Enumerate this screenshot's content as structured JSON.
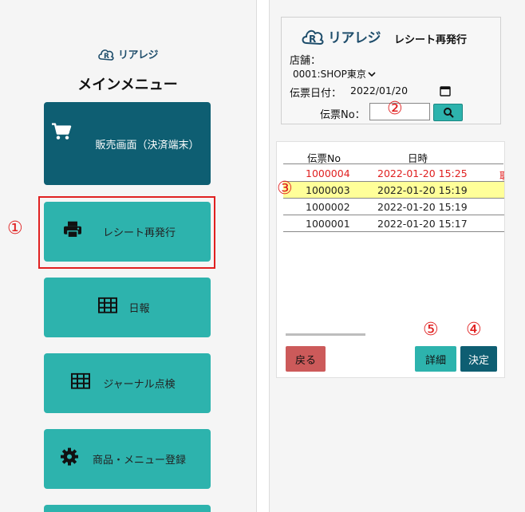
{
  "left": {
    "logo_text": "リアレジ",
    "menu_title": "メインメニュー",
    "buttons": {
      "sales": "販売画面（決済端末）",
      "receipt": "レシート再発行",
      "daily": "日報",
      "journal": "ジャーナル点検",
      "product": "商品・メニュー登録"
    },
    "marker_1": "①"
  },
  "right": {
    "logo_text": "リアレジ",
    "title": "レシート再発行",
    "store_label": "店舗：",
    "store_value": "0001:SHOP東京",
    "date_label": "伝票日付：",
    "date_value": "2022/01/20",
    "slip_label": "伝票No：",
    "slip_value": "",
    "columns": {
      "slip_no": "伝票No",
      "datetime": "日時"
    },
    "rows": [
      {
        "slip_no": "1000004",
        "datetime": "2022-01-20 15:25",
        "extra": "取"
      },
      {
        "slip_no": "1000003",
        "datetime": "2022-01-20 15:19",
        "extra": ""
      },
      {
        "slip_no": "1000002",
        "datetime": "2022-01-20 15:19",
        "extra": ""
      },
      {
        "slip_no": "1000001",
        "datetime": "2022-01-20 15:17",
        "extra": ""
      }
    ],
    "buttons": {
      "back": "戻る",
      "detail": "詳細",
      "ok": "決定"
    },
    "markers": {
      "m2": "②",
      "m3": "③",
      "m4": "④",
      "m5": "⑤"
    }
  },
  "colors": {
    "teal": "#2db3ad",
    "dark_teal": "#0e5e72",
    "red": "#e02020",
    "back_btn": "#cc5a5a",
    "selected_row": "#ffff99"
  },
  "icons": {
    "sales": "cart-icon",
    "receipt": "printer-icon",
    "daily": "table-icon",
    "journal": "table-icon",
    "product": "gear-icon",
    "search": "search-icon",
    "calendar": "calendar-icon"
  }
}
